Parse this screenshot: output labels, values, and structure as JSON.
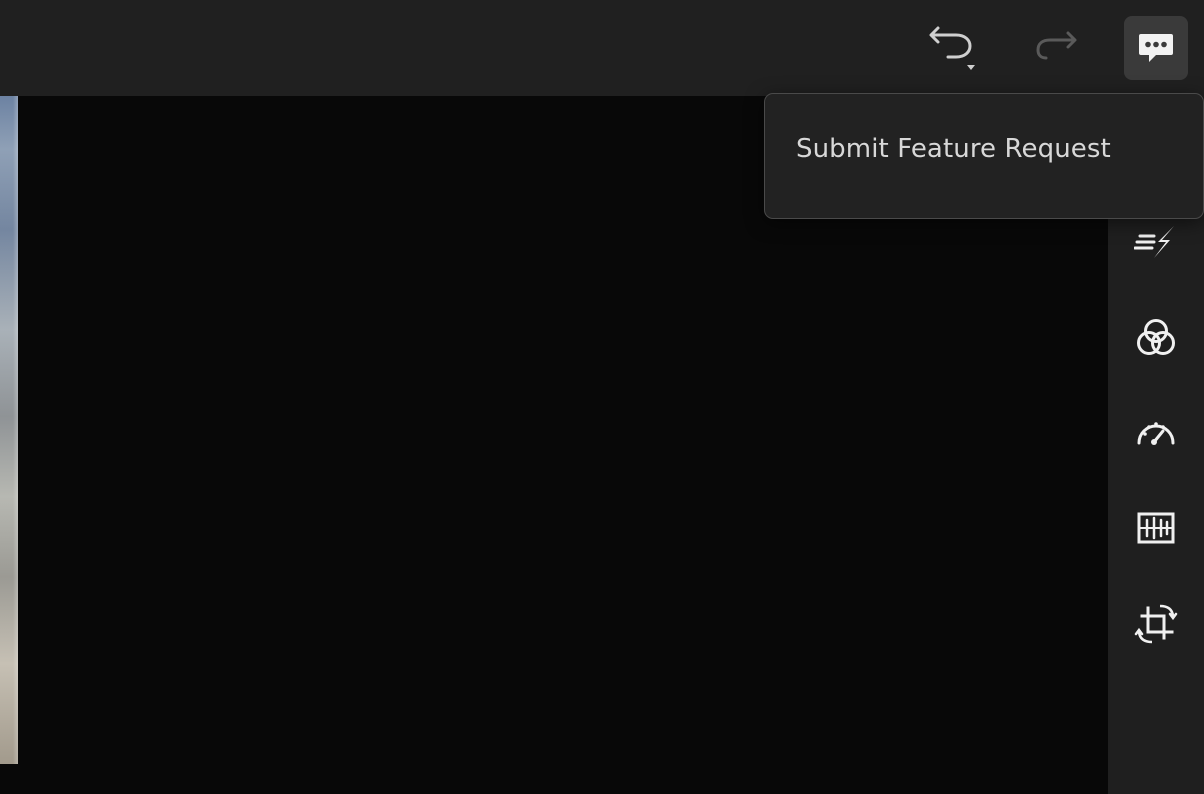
{
  "topbar": {
    "undo": {
      "icon": "undo-icon",
      "dropdown_icon": "caret-down-icon",
      "color": "#cfcfcf"
    },
    "redo": {
      "icon": "redo-icon",
      "color": "#5a5a5a",
      "enabled": false
    },
    "feedback": {
      "icon": "feedback-speech-bubble-icon",
      "active": true,
      "bg": "#3a3a3a"
    }
  },
  "popover": {
    "items": [
      {
        "label": "Submit Feature Request"
      }
    ]
  },
  "rail": {
    "tools": [
      {
        "icon": "quick-actions-icon"
      },
      {
        "icon": "color-mixer-icon"
      },
      {
        "icon": "light-speedometer-icon"
      },
      {
        "icon": "effects-waveform-icon"
      },
      {
        "icon": "crop-rotate-icon"
      }
    ]
  },
  "colors": {
    "topbar_bg": "#202020",
    "canvas_bg": "#080808",
    "rail_bg": "#1f1f1f",
    "icon": "#f0f0f0"
  }
}
